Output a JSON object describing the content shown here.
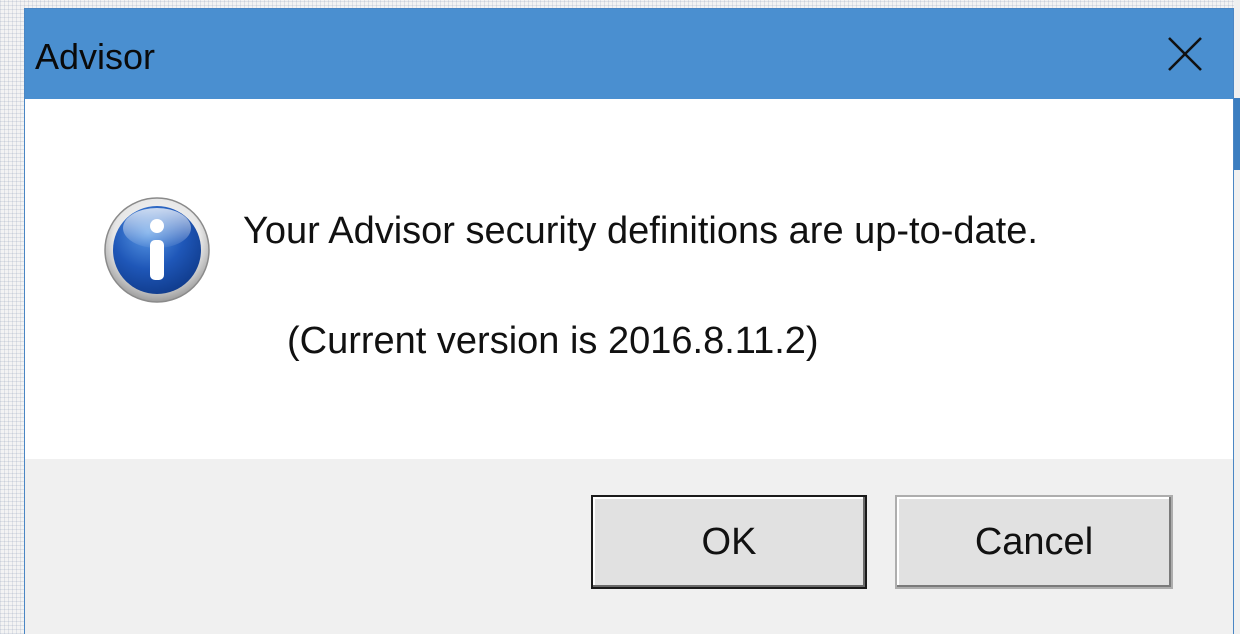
{
  "dialog": {
    "title": "Advisor",
    "message": "Your Advisor security definitions are up-to-date.",
    "version_text": "(Current version is 2016.8.11.2)",
    "icon": "info-icon",
    "buttons": {
      "ok_label": "OK",
      "cancel_label": "Cancel"
    }
  },
  "colors": {
    "titlebar": "#4a8fd0",
    "footer": "#f0f0f0",
    "icon_blue": "#1f57b8"
  }
}
